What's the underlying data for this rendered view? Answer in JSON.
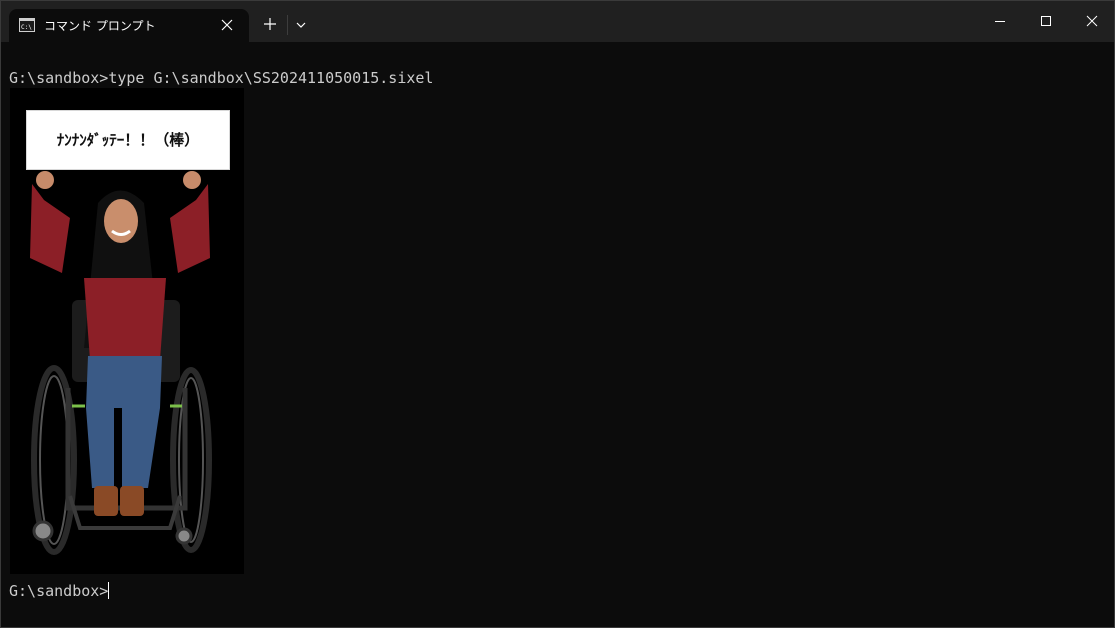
{
  "window": {
    "tab_title": "コマンド プロンプト",
    "tab_icon": "command-prompt-icon",
    "controls": [
      "minimize-icon",
      "maximize-icon",
      "close-icon"
    ]
  },
  "terminal": {
    "line1": "G:\\sandbox>type G:\\sandbox\\SS202411050015.sixel",
    "prompt": "G:\\sandbox>",
    "image": {
      "sign_text": "ﾅﾝﾅﾝﾀﾞｯﾃｰ！！（棒）"
    }
  },
  "colors": {
    "background": "#0c0c0c",
    "titlebar": "#202020",
    "text": "#cccccc",
    "shirt": "#8c1f27",
    "jeans": "#3a5a86"
  }
}
